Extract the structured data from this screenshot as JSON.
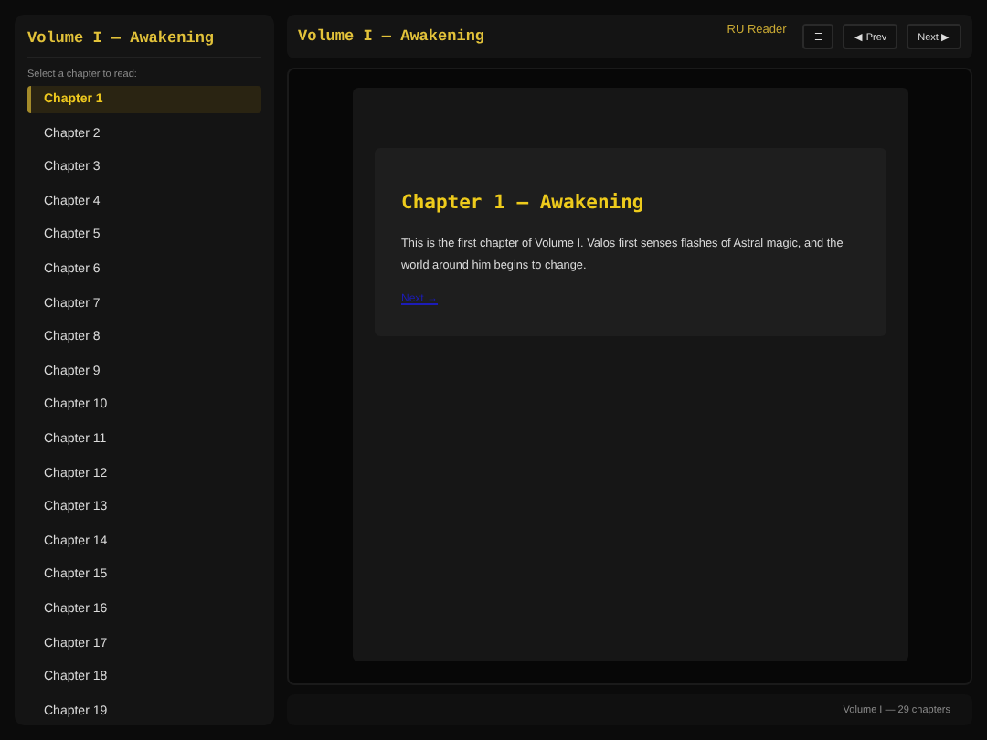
{
  "sidebar": {
    "title": "Volume I — Awakening",
    "hint": "Select a chapter to read:",
    "chapters": [
      {
        "label": "Chapter 1",
        "selected": true
      },
      {
        "label": "Chapter 2",
        "selected": false
      },
      {
        "label": "Chapter 3",
        "selected": false
      },
      {
        "label": "Chapter 4",
        "selected": false
      },
      {
        "label": "Chapter 5",
        "selected": false
      },
      {
        "label": "Chapter 6",
        "selected": false
      },
      {
        "label": "Chapter 7",
        "selected": false
      },
      {
        "label": "Chapter 8",
        "selected": false
      },
      {
        "label": "Chapter 9",
        "selected": false
      },
      {
        "label": "Chapter 10",
        "selected": false
      },
      {
        "label": "Chapter 11",
        "selected": false
      },
      {
        "label": "Chapter 12",
        "selected": false
      },
      {
        "label": "Chapter 13",
        "selected": false
      },
      {
        "label": "Chapter 14",
        "selected": false
      },
      {
        "label": "Chapter 15",
        "selected": false
      },
      {
        "label": "Chapter 16",
        "selected": false
      },
      {
        "label": "Chapter 17",
        "selected": false
      },
      {
        "label": "Chapter 18",
        "selected": false
      },
      {
        "label": "Chapter 19",
        "selected": false
      }
    ]
  },
  "header": {
    "title": "Volume I — Awakening",
    "brand": "RU Reader",
    "menu_button": "☰",
    "prev_button": "◀ Prev",
    "next_button": "Next ▶"
  },
  "chapter": {
    "title": "Chapter 1 — Awakening",
    "body": "This is the first chapter of Volume I. Valos first senses flashes of Astral magic, and the world around him begins to change.",
    "link": "Next →"
  },
  "footer": "Volume I — 29 chapters"
}
